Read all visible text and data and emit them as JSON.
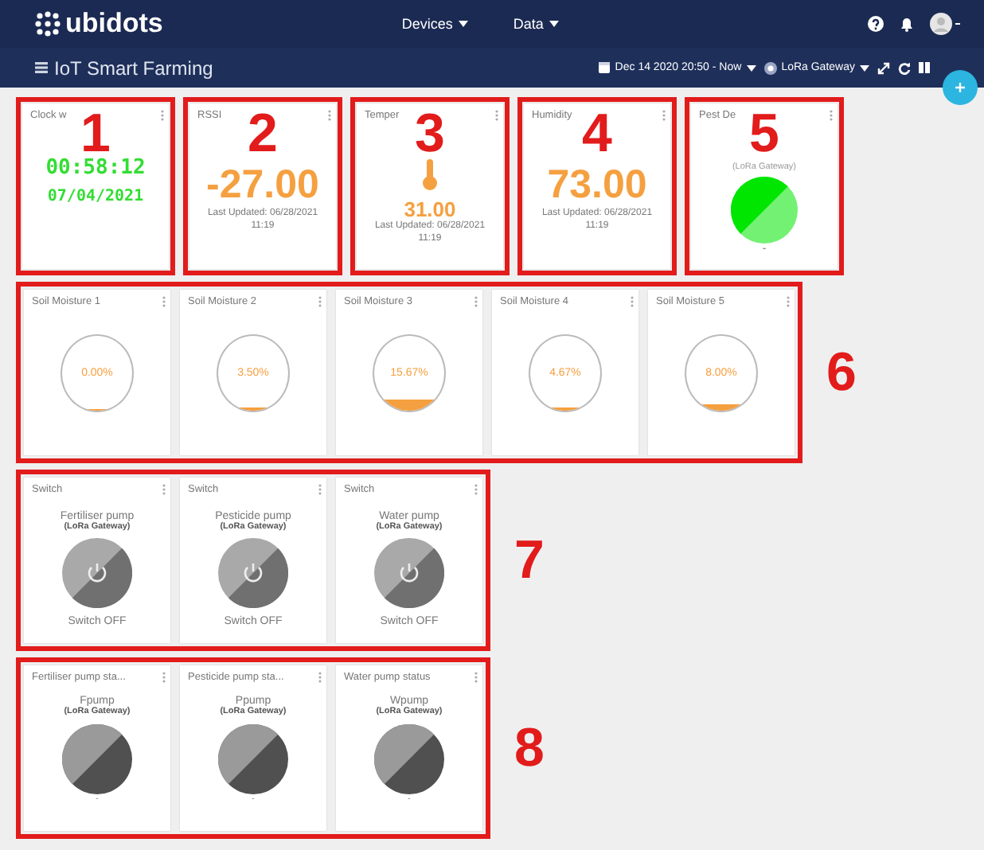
{
  "navbar": {
    "logo": "ubidots",
    "menus": [
      {
        "label": "Devices"
      },
      {
        "label": "Data"
      }
    ]
  },
  "dashboard": {
    "title": "IoT Smart Farming",
    "date_range": "Dec 14 2020 20:50 - Now",
    "device": "LoRa Gateway"
  },
  "rows": [
    {
      "widgets": [
        {
          "kind": "clock",
          "annotation": "1",
          "title": "Clock w",
          "time": "00:58:12",
          "date": "07/04/2021"
        },
        {
          "kind": "metric",
          "annotation": "2",
          "title": "RSSI",
          "value": "-27.00",
          "updated": "Last Updated: 06/28/2021 11:19"
        },
        {
          "kind": "thermometer",
          "annotation": "3",
          "title": "Temper",
          "value": "31.00",
          "updated": "Last Updated: 06/28/2021 11:19"
        },
        {
          "kind": "metric",
          "annotation": "4",
          "title": "Humidity",
          "value": "73.00",
          "updated": "Last Updated: 06/28/2021 11:19"
        },
        {
          "kind": "indicator",
          "annotation": "5",
          "title": "Pest De",
          "device": "(LoRa Gateway)",
          "color": "#00e600",
          "footer": "-"
        }
      ]
    },
    {
      "annotation": "6",
      "widgets": [
        {
          "kind": "gauge",
          "title": "Soil Moisture 1",
          "value": "0.00%",
          "level": 0
        },
        {
          "kind": "gauge",
          "title": "Soil Moisture 2",
          "value": "3.50%",
          "level": 0.035
        },
        {
          "kind": "gauge",
          "title": "Soil Moisture 3",
          "value": "15.67%",
          "level": 0.1567
        },
        {
          "kind": "gauge",
          "title": "Soil Moisture 4",
          "value": "4.67%",
          "level": 0.0467
        },
        {
          "kind": "gauge",
          "title": "Soil Moisture 5",
          "value": "8.00%",
          "level": 0.08
        }
      ]
    },
    {
      "annotation": "7",
      "widgets": [
        {
          "kind": "switch",
          "title": "Switch",
          "name": "Fertiliser pump",
          "device": "(LoRa Gateway)",
          "on": false,
          "status": "Switch OFF"
        },
        {
          "kind": "switch",
          "title": "Switch",
          "name": "Pesticide pump",
          "device": "(LoRa Gateway)",
          "on": false,
          "status": "Switch OFF"
        },
        {
          "kind": "switch",
          "title": "Switch",
          "name": "Water pump",
          "device": "(LoRa Gateway)",
          "on": false,
          "status": "Switch OFF"
        }
      ]
    },
    {
      "annotation": "8",
      "widgets": [
        {
          "kind": "status",
          "title": "Fertiliser pump sta...",
          "name": "Fpump",
          "device": "(LoRa Gateway)",
          "on": false,
          "footer": "-"
        },
        {
          "kind": "status",
          "title": "Pesticide pump sta...",
          "name": "Ppump",
          "device": "(LoRa Gateway)",
          "on": false,
          "footer": "-"
        },
        {
          "kind": "status",
          "title": "Water pump status",
          "name": "Wpump",
          "device": "(LoRa Gateway)",
          "on": false,
          "footer": "-"
        }
      ]
    }
  ]
}
